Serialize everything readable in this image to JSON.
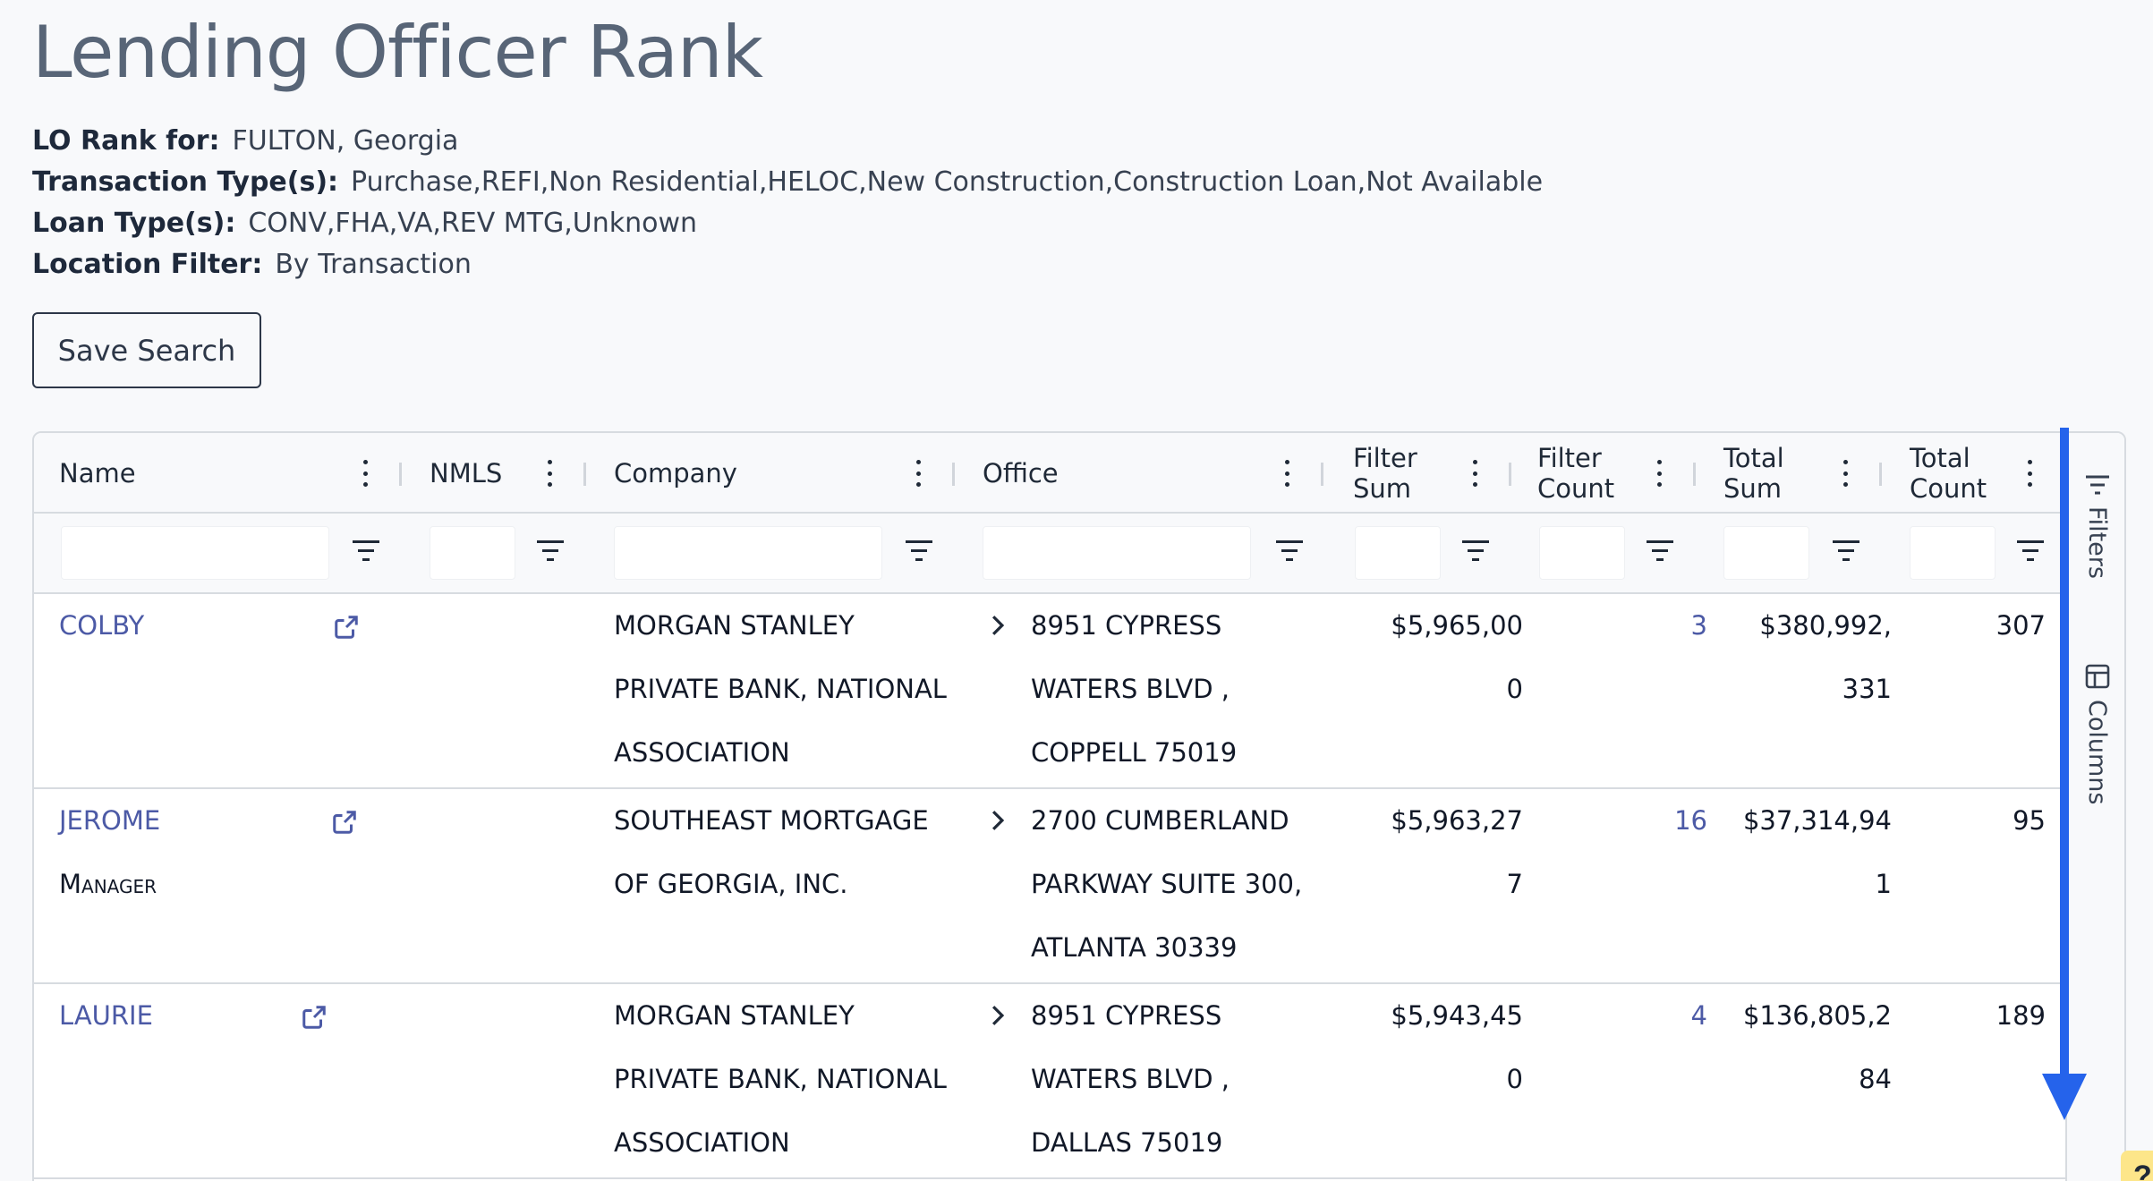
{
  "page": {
    "title": "Lending Officer Rank",
    "meta": [
      {
        "label": "LO Rank for:",
        "value": "FULTON, Georgia"
      },
      {
        "label": "Transaction Type(s):",
        "value": "Purchase,REFI,Non Residential,HELOC,New Construction,Construction Loan,Not Available"
      },
      {
        "label": "Loan Type(s):",
        "value": "CONV,FHA,VA,REV MTG,Unknown"
      },
      {
        "label": "Location Filter:",
        "value": "By Transaction"
      }
    ],
    "save_button": "Save Search"
  },
  "grid": {
    "columns": [
      {
        "key": "name",
        "label": "Name"
      },
      {
        "key": "nmls",
        "label": "NMLS"
      },
      {
        "key": "company",
        "label": "Company"
      },
      {
        "key": "office",
        "label": "Office"
      },
      {
        "key": "filter_sum",
        "label": "Filter Sum"
      },
      {
        "key": "filter_count",
        "label": "Filter Count"
      },
      {
        "key": "total_sum",
        "label": "Total Sum"
      },
      {
        "key": "total_count",
        "label": "Total Count"
      }
    ],
    "rows": [
      {
        "name": "COLBY",
        "name_sub": "",
        "company": [
          "MORGAN STANLEY",
          "PRIVATE BANK, NATIONAL",
          "ASSOCIATION"
        ],
        "office": [
          "8951 CYPRESS",
          "WATERS BLVD ,",
          "COPPELL 75019"
        ],
        "filter_sum": [
          "$5,965,00",
          "0"
        ],
        "filter_count": "3",
        "total_sum": [
          "$380,992,",
          "331"
        ],
        "total_count": "307"
      },
      {
        "name": "JEROME",
        "name_sub": "Manager",
        "company": [
          "SOUTHEAST MORTGAGE",
          "OF GEORGIA, INC."
        ],
        "office": [
          "2700 CUMBERLAND",
          "PARKWAY SUITE 300,",
          "ATLANTA 30339"
        ],
        "filter_sum": [
          "$5,963,27",
          "7"
        ],
        "filter_count": "16",
        "total_sum": [
          "$37,314,94",
          "1"
        ],
        "total_count": "95"
      },
      {
        "name": "LAURIE",
        "name_sub": "",
        "company": [
          "MORGAN STANLEY",
          "PRIVATE BANK, NATIONAL",
          "ASSOCIATION"
        ],
        "office": [
          "8951 CYPRESS",
          "WATERS BLVD ,",
          "DALLAS 75019"
        ],
        "filter_sum": [
          "$5,943,45",
          "0"
        ],
        "filter_count": "4",
        "total_sum": [
          "$136,805,2",
          "84"
        ],
        "total_count": "189"
      }
    ]
  },
  "side_panel": {
    "filters_label": "Filters",
    "columns_label": "Columns"
  },
  "help_badge": "?",
  "icons": {
    "kebab": "more-vertical-icon",
    "filter": "filter-lines-icon",
    "external": "external-link-icon",
    "chevron": "chevron-right-icon"
  },
  "colors": {
    "link": "#4c5aa6",
    "title": "#586577",
    "scroll_indicator": "#2563eb"
  }
}
